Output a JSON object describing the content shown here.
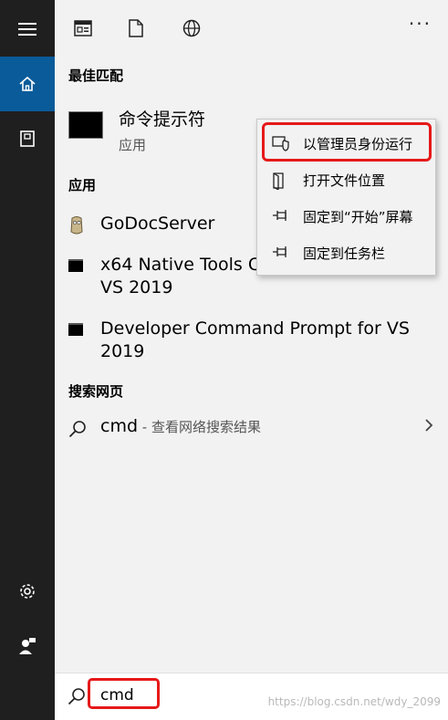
{
  "rail": {
    "items": [
      "menu",
      "home",
      "documents",
      "settings",
      "account"
    ]
  },
  "topbar": {
    "more_label": "···"
  },
  "best_match": {
    "heading": "最佳匹配",
    "title": "命令提示符",
    "subtitle": "应用"
  },
  "apps": {
    "heading": "应用",
    "items": [
      {
        "label": "GoDocServer"
      },
      {
        "label_line1": "x64 Native Tools Co",
        "label_line2": "VS 2019"
      },
      {
        "label_line1": "Developer Command Prompt for VS",
        "label_line2": "2019"
      }
    ]
  },
  "web": {
    "heading": "搜索网页",
    "query": "cmd",
    "hint": " - 查看网络搜索结果"
  },
  "context_menu": {
    "items": [
      {
        "label": "以管理员身份运行",
        "icon": "shield-icon"
      },
      {
        "label": "打开文件位置",
        "icon": "folder-open-icon"
      },
      {
        "label": "固定到“开始”屏幕",
        "icon": "pin-icon"
      },
      {
        "label": "固定到任务栏",
        "icon": "pin-icon"
      }
    ]
  },
  "search": {
    "value": "cmd"
  },
  "watermark": "https://blog.csdn.net/wdy_2099",
  "colors": {
    "accent": "#0a5b9a",
    "highlight": "#e61919",
    "rail": "#1f1f1f"
  }
}
